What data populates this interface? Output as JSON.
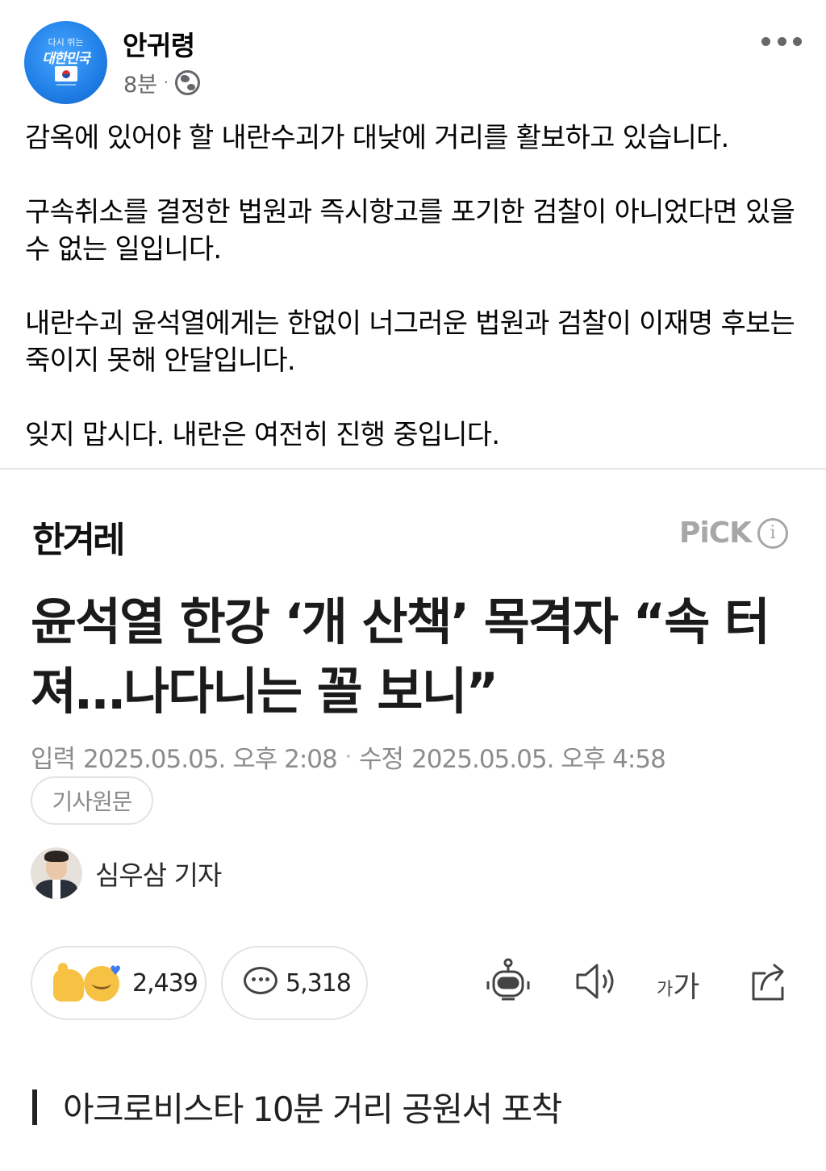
{
  "post": {
    "author": "안귀령",
    "avatar_text_small": "다시 뛰는",
    "avatar_text_big": "대한민국",
    "time": "8분",
    "separator": "·",
    "paragraphs": [
      "감옥에 있어야 할 내란수괴가 대낮에 거리를 활보하고 있습니다.",
      "구속취소를 결정한 법원과 즉시항고를 포기한 검찰이 아니었다면 있을 수 없는 일입니다.",
      "내란수괴 윤석열에게는 한없이 너그러운 법원과 검찰이 이재명 후보는 죽이지 못해 안달입니다.",
      "잊지 맙시다. 내란은 여전히 진행 중입니다."
    ]
  },
  "article": {
    "publisher": "한겨레",
    "pick_label": "PiCK",
    "info_symbol": "i",
    "headline": "윤석열 한강 ‘개 산책’ 목격자 “속 터져…나다니는 꼴 보니”",
    "published_label": "입력",
    "published": "2025.05.05. 오후 2:08",
    "date_separator": "•",
    "modified_label": "수정",
    "modified": "2025.05.05. 오후 4:58",
    "original_button": "기사원문",
    "reporter": "심우삼 기자",
    "reactions_count": "2,439",
    "comments_count": "5,318",
    "fontsize_small": "가",
    "fontsize_large": "가",
    "subheading": "아크로비스타 10분 거리 공원서 포착"
  },
  "icons": [
    "globe-icon",
    "more-icon",
    "info-icon",
    "reaction-icon",
    "comment-icon",
    "robot-icon",
    "speaker-icon",
    "fontsize-icon",
    "share-icon"
  ],
  "colors": {
    "text": "#050505",
    "meta": "#65676b",
    "muted": "#8c8c8c",
    "pick": "#a7a7a7",
    "emoji": "#f7c244"
  }
}
